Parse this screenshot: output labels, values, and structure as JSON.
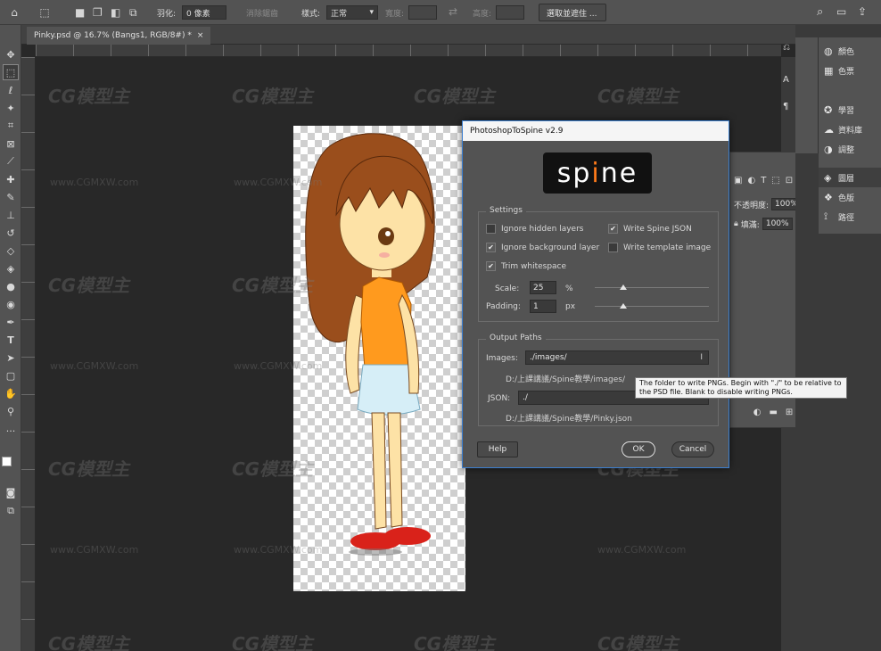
{
  "options_bar": {
    "feather_label": "羽化:",
    "feather_value": "0 像素",
    "antialias_label": "消除鋸齒",
    "style_label": "樣式:",
    "style_value": "正常",
    "width_label": "寬度:",
    "height_label": "高度:",
    "select_mask_label": "選取並遮住 ..."
  },
  "document_tab": {
    "title": "Pinky.psd @ 16.7% (Bangs1, RGB/8#) *",
    "close": "×"
  },
  "tools": [
    "move",
    "marquee",
    "lasso",
    "magic-wand",
    "crop",
    "frame",
    "eyedropper",
    "healing",
    "brush",
    "stamp",
    "history-brush",
    "eraser",
    "gradient",
    "blur",
    "dodge",
    "pen",
    "type",
    "path-select",
    "shape",
    "hand",
    "zoom",
    "more"
  ],
  "right_dock": {
    "items": [
      {
        "label": "顏色",
        "icon": "color-icon"
      },
      {
        "label": "色票",
        "icon": "swatches-icon"
      },
      {
        "label": "學習",
        "icon": "learn-icon"
      },
      {
        "label": "資料庫",
        "icon": "libraries-icon"
      },
      {
        "label": "調整",
        "icon": "adjustments-icon"
      },
      {
        "label": "圖層",
        "icon": "layers-icon"
      },
      {
        "label": "色版",
        "icon": "channels-icon"
      },
      {
        "label": "路徑",
        "icon": "paths-icon"
      }
    ],
    "active_index": 5
  },
  "layers_panel": {
    "opacity_label": "不透明度:",
    "opacity_value": "100%",
    "fill_label": "填滿:",
    "fill_value": "100%"
  },
  "dialog": {
    "title": "PhotoshopToSpine v2.9",
    "logo": {
      "pre": "sp",
      "accent": "i",
      "post": "ne"
    },
    "settings": {
      "legend": "Settings",
      "ignore_hidden_layers": {
        "label": "Ignore hidden layers",
        "checked": false
      },
      "ignore_background_layer": {
        "label": "Ignore background layer",
        "checked": true
      },
      "trim_whitespace": {
        "label": "Trim whitespace",
        "checked": true
      },
      "write_spine_json": {
        "label": "Write Spine JSON",
        "checked": true
      },
      "write_template_image": {
        "label": "Write template image",
        "checked": false
      },
      "scale_label": "Scale:",
      "scale_value": "25",
      "scale_unit": "%",
      "padding_label": "Padding:",
      "padding_value": "1",
      "padding_unit": "px",
      "scale_slider": 0.25,
      "padding_slider": 0.25
    },
    "output_paths": {
      "legend": "Output Paths",
      "images_label": "Images:",
      "images_value": "./images/",
      "images_resolved": "D:/上課講議/Spine教學/images/",
      "json_label": "JSON:",
      "json_value": "./",
      "json_resolved": "D:/上課講議/Spine教學/Pinky.json"
    },
    "help_button": "Help",
    "ok_button": "OK",
    "cancel_button": "Cancel",
    "tooltip": "The folder to write PNGs. Begin with \"./\" to be relative to the PSD file. Blank to disable writing PNGs."
  },
  "watermark": {
    "logo": "CG模型主",
    "url": "www.CGMXW.com"
  },
  "colors": {
    "orange_dress": "#ff9a1e",
    "hair": "#9a4e1c",
    "skirt": "#d6eef7",
    "shoes": "#d9221a",
    "skin": "#fde2a6"
  }
}
